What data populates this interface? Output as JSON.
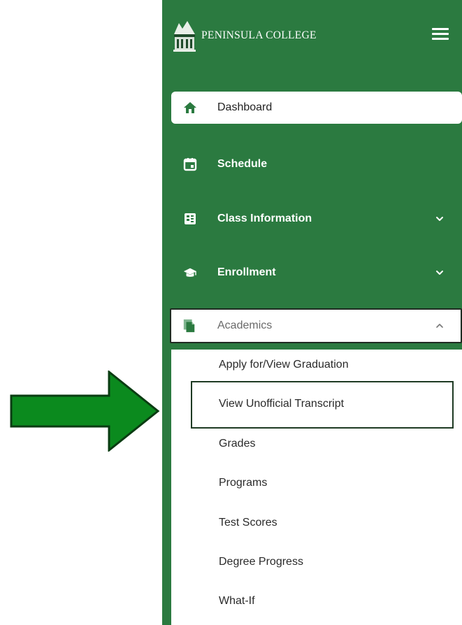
{
  "brand": {
    "name": "PENINSULA COLLEGE",
    "logo_icon": "college-building-logo",
    "menu_icon": "hamburger-icon"
  },
  "nav": {
    "items": [
      {
        "label": "Dashboard",
        "icon": "home-icon",
        "state": "active"
      },
      {
        "label": "Schedule",
        "icon": "calendar-icon"
      },
      {
        "label": "Class Information",
        "icon": "class-info-icon",
        "expandable": true,
        "expanded": false
      },
      {
        "label": "Enrollment",
        "icon": "graduation-cap-icon",
        "expandable": true,
        "expanded": false
      },
      {
        "label": "Academics",
        "icon": "documents-icon",
        "expandable": true,
        "expanded": true
      }
    ]
  },
  "academics_submenu": {
    "items": [
      "Apply for/View Graduation",
      "View Unofficial Transcript",
      "Grades",
      "Programs",
      "Test Scores",
      "Degree Progress",
      "What-If"
    ],
    "highlighted_item": "View Unofficial Transcript"
  },
  "annotation": {
    "arrow_icon": "pointer-arrow-icon"
  },
  "colors": {
    "sidebar_green": "#2b7a40",
    "arrow_green": "#0b8a1e",
    "highlight_border": "#1e3a23",
    "active_bg": "#ffffff"
  }
}
